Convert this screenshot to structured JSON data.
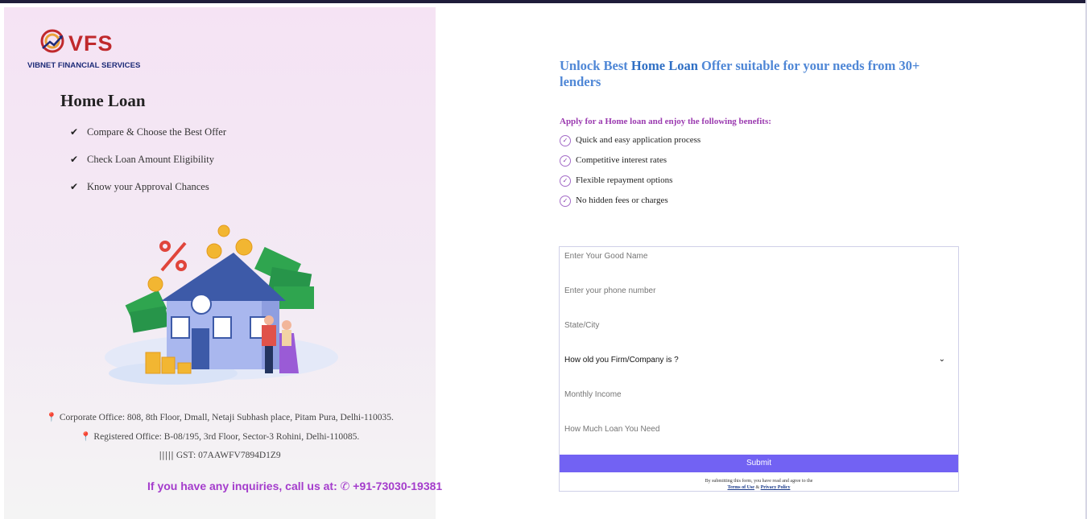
{
  "brand": {
    "logo_text": "VFS",
    "company_name": "VIBNET FINANCIAL SERVICES"
  },
  "left": {
    "title": "Home Loan",
    "features": [
      "Compare & Choose the Best Offer",
      "Check Loan Amount Eligibility",
      "Know your Approval Chances"
    ],
    "corporate_office": "Corporate Office: 808, 8th Floor, Dmall, Netaji Subhash place, Pitam Pura, Delhi-110035.",
    "registered_office": "Registered Office: B-08/195, 3rd Floor, Sector-3 Rohini, Delhi-110085.",
    "gst": "GST: 07AAWFV7894D1Z9",
    "inquiry_text": "If you have any inquiries, call us at:",
    "phone": "+91-73030-19381"
  },
  "right": {
    "headline_prefix": "Unlock Best ",
    "headline_highlight": "Home Loan",
    "headline_suffix": " Offer suitable for your needs from 30+ lenders",
    "benefits_title": "Apply for a Home loan and enjoy the following benefits:",
    "benefits": [
      "Quick and easy application process",
      "Competitive interest rates",
      "Flexible repayment options",
      "No hidden fees or charges"
    ]
  },
  "form": {
    "name_placeholder": "Enter Your Good Name",
    "phone_placeholder": "Enter your phone number",
    "city_placeholder": "State/City",
    "company_age_selected": "How old you Firm/Company is ?",
    "income_placeholder": "Monthly Income",
    "loan_placeholder": "How Much Loan You Need",
    "submit_label": "Submit",
    "terms_prefix": "By submitting this form, you have read and agree to the",
    "terms_link": "Terms of Use",
    "terms_and": " & ",
    "privacy_link": "Privacy Policy"
  },
  "colors": {
    "accent": "#7262f3",
    "headline": "#4f87d6",
    "benefits_title": "#9b3bb0",
    "inquiry": "#a43ccc",
    "brand_red": "#c0292c",
    "brand_blue": "#1d2b78"
  },
  "icons": [
    "check-icon",
    "map-pin-icon",
    "barcode-icon",
    "phone-icon",
    "check-circle-icon",
    "chevron-down-icon"
  ]
}
